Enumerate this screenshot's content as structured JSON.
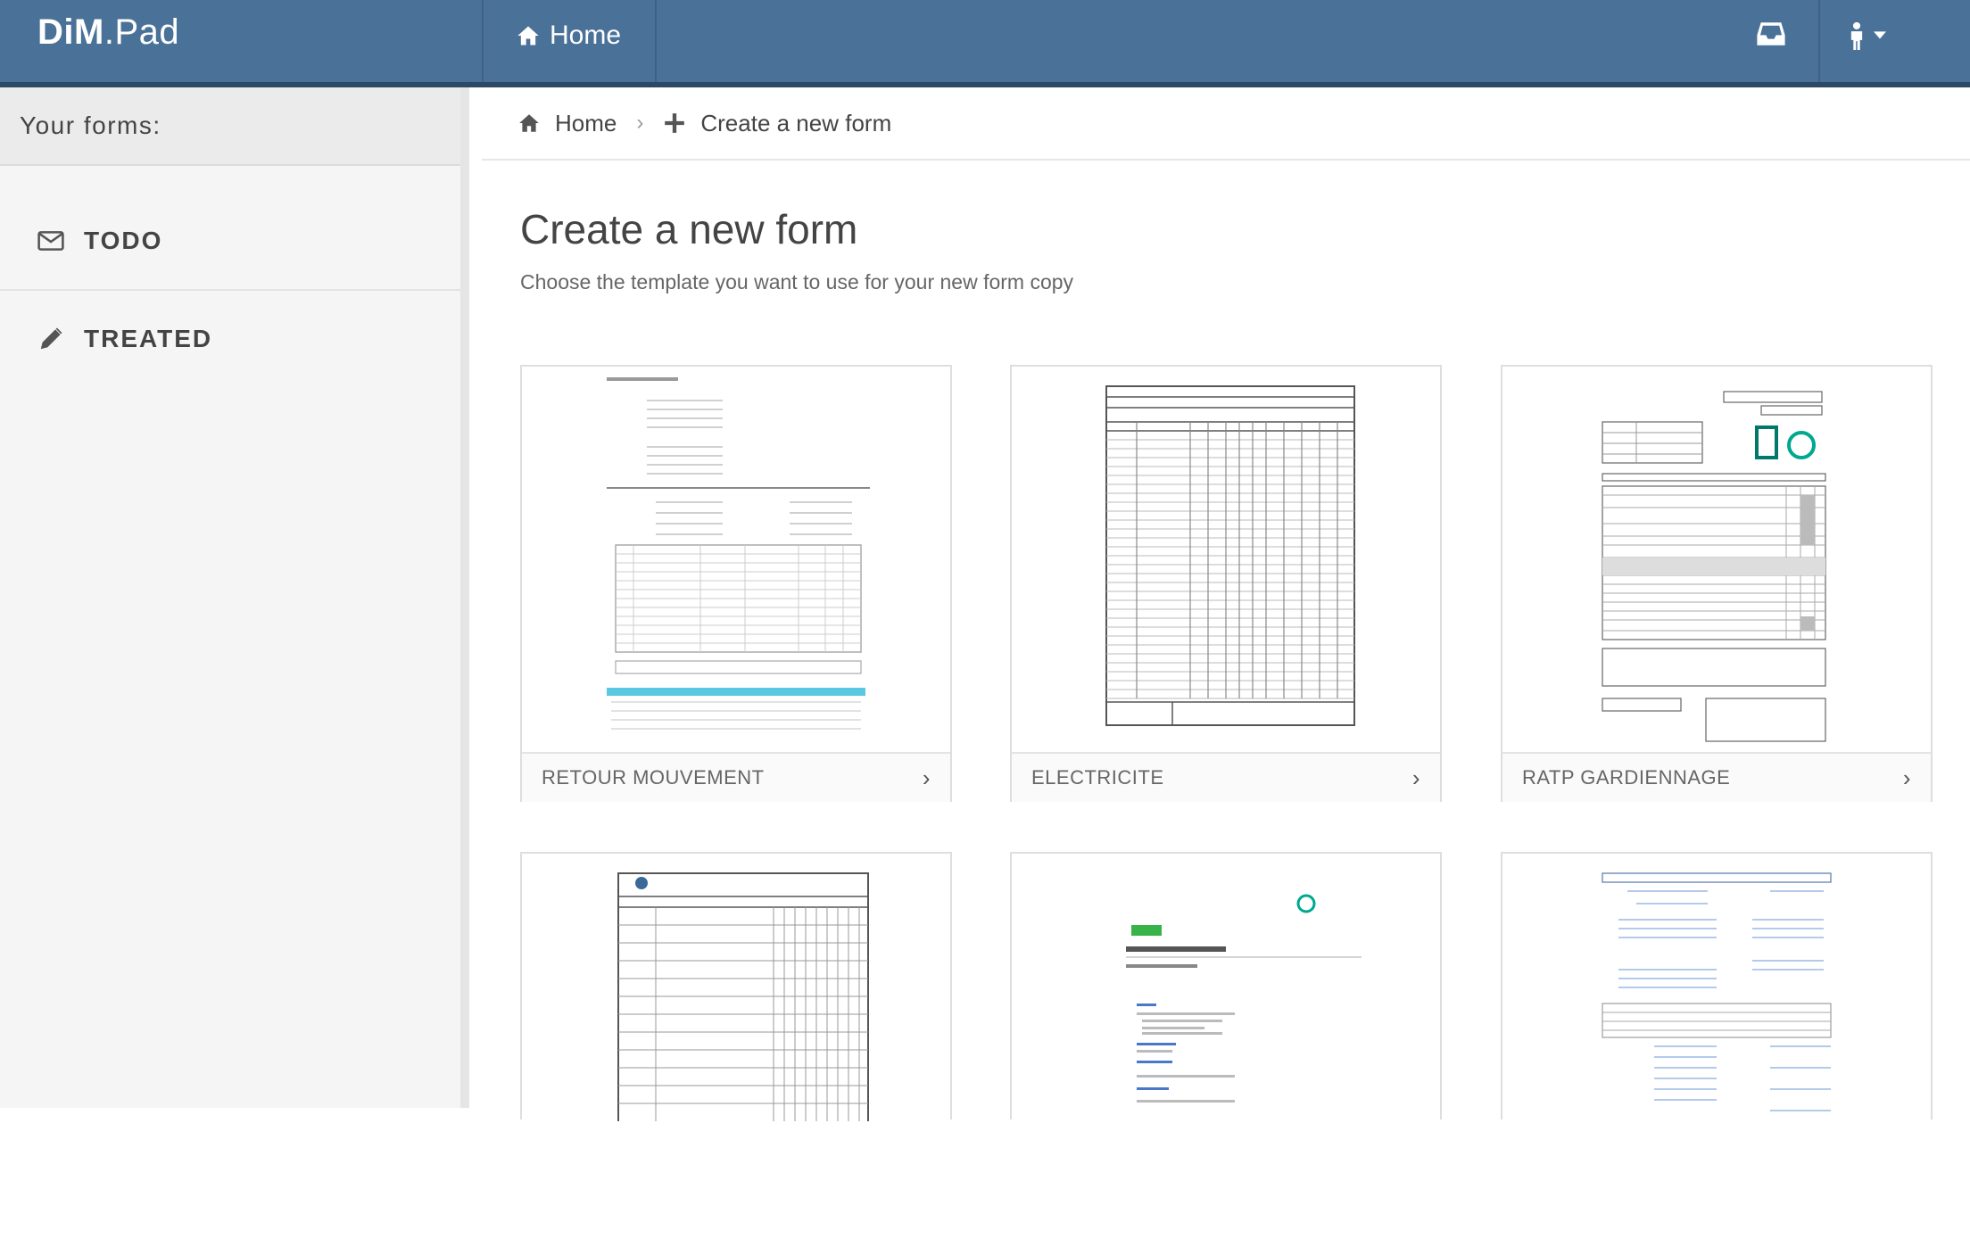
{
  "app": {
    "brand_bold": "DiM",
    "brand_rest": ".Pad"
  },
  "nav": {
    "home_label": "Home"
  },
  "sidebar": {
    "header": "Your forms:",
    "items": [
      {
        "label": "TODO",
        "icon": "envelope-icon"
      },
      {
        "label": "TREATED",
        "icon": "pencil-icon"
      }
    ]
  },
  "breadcrumb": {
    "home": "Home",
    "current": "Create a new form"
  },
  "main": {
    "title": "Create a new form",
    "subtitle": "Choose the template you want to use for your new form copy"
  },
  "templates": [
    {
      "name": "RETOUR MOUVEMENT"
    },
    {
      "name": "ELECTRICITE"
    },
    {
      "name": "RATP GARDIENNAGE"
    },
    {
      "name": ""
    },
    {
      "name": ""
    },
    {
      "name": ""
    }
  ],
  "colors": {
    "navbar": "#4a7299",
    "accent": "#4a7299"
  }
}
